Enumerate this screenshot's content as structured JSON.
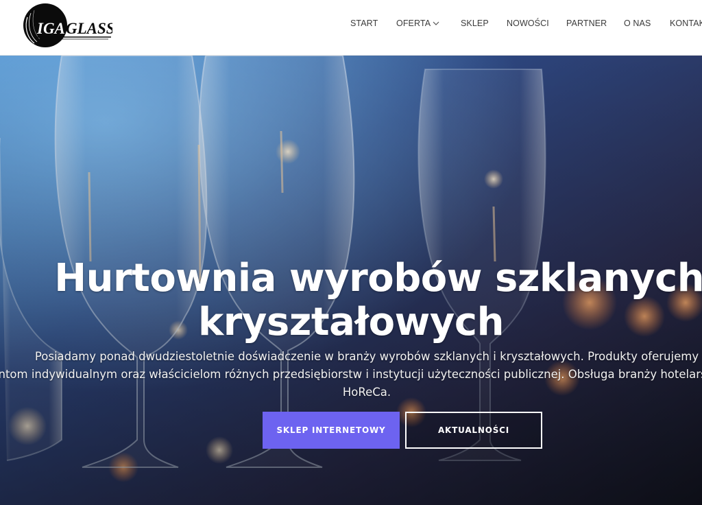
{
  "header": {
    "logo_text": "IGA GLASS",
    "nav": {
      "start": "START",
      "oferta": "OFERTA",
      "sklep": "SKLEP",
      "nowosci": "NOWOŚCI",
      "partner": "PARTNER",
      "o_nas": "O NAS",
      "kontakt": "KONTAKT"
    }
  },
  "hero": {
    "title_line1": "Hurtownia wyrobów szklanych i",
    "title_line2": "kryształowych",
    "desc_line1": "Posiadamy ponad dwudziestoletnie doświadczenie w branży wyrobów szklanych i kryształowych.  Produkty oferujemy",
    "desc_line2": "klientom indywidualnym oraz właścicielom różnych przedsiębiorstw i instytucji użyteczności publicznej. Obsługa branży hotelarskiej czyli",
    "desc_line3": "HoReCa.",
    "btn_shop": "SKLEP INTERNETOWY",
    "btn_news": "AKTUALNOŚCI"
  },
  "colors": {
    "accent": "#6d63f0",
    "header_bg": "#ffffff",
    "nav_text": "#3a3a3a"
  },
  "icons": {
    "dropdown": "chevron-down-icon"
  }
}
